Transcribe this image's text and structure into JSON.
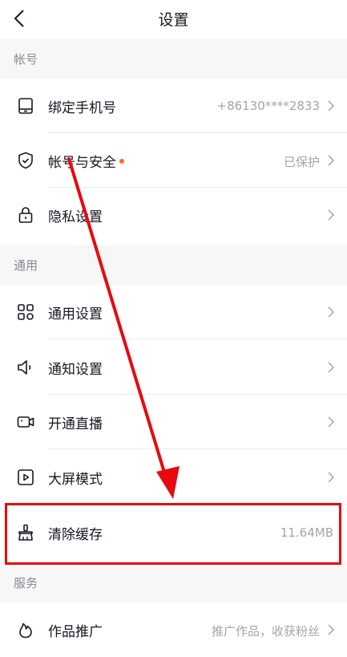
{
  "header": {
    "title": "设置"
  },
  "sections": {
    "account": "帐号",
    "general": "通用",
    "service": "服务"
  },
  "rows": {
    "bind_phone": {
      "label": "绑定手机号",
      "value": "+86130****2833"
    },
    "account_security": {
      "label": "帐号与安全",
      "value": "已保护"
    },
    "privacy": {
      "label": "隐私设置"
    },
    "general_settings": {
      "label": "通用设置"
    },
    "notifications": {
      "label": "通知设置"
    },
    "live": {
      "label": "开通直播"
    },
    "big_screen": {
      "label": "大屏模式"
    },
    "clear_cache": {
      "label": "清除缓存",
      "value": "11.64MB"
    },
    "promote": {
      "label": "作品推广",
      "value": "推广作品，收获粉丝"
    }
  },
  "colors": {
    "annotation_red": "#e8090f",
    "badge_dot": "#fe6a25"
  },
  "icons": [
    "back-icon",
    "phone-icon",
    "shield-icon",
    "lock-icon",
    "grid-icon",
    "speaker-icon",
    "camera-icon",
    "play-icon",
    "brush-icon",
    "flame-icon",
    "chevron-right-icon"
  ]
}
